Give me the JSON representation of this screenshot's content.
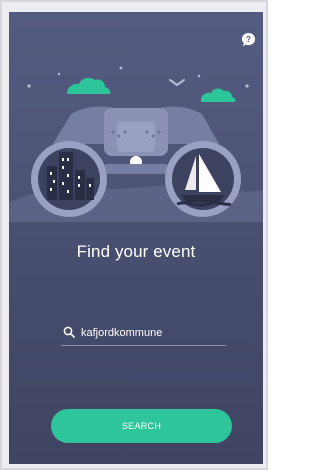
{
  "help": {
    "icon": "question-bubble-icon"
  },
  "main": {
    "title": "Find your event",
    "illustration": "binoculars-city-sailboat-illustration"
  },
  "search": {
    "icon": "search-icon",
    "value": "kafjordkommune",
    "button_label": "SEARCH"
  },
  "colors": {
    "background_top": "#545b81",
    "background_bottom": "#3f4462",
    "accent": "#2fc59a",
    "text": "#ffffff"
  }
}
